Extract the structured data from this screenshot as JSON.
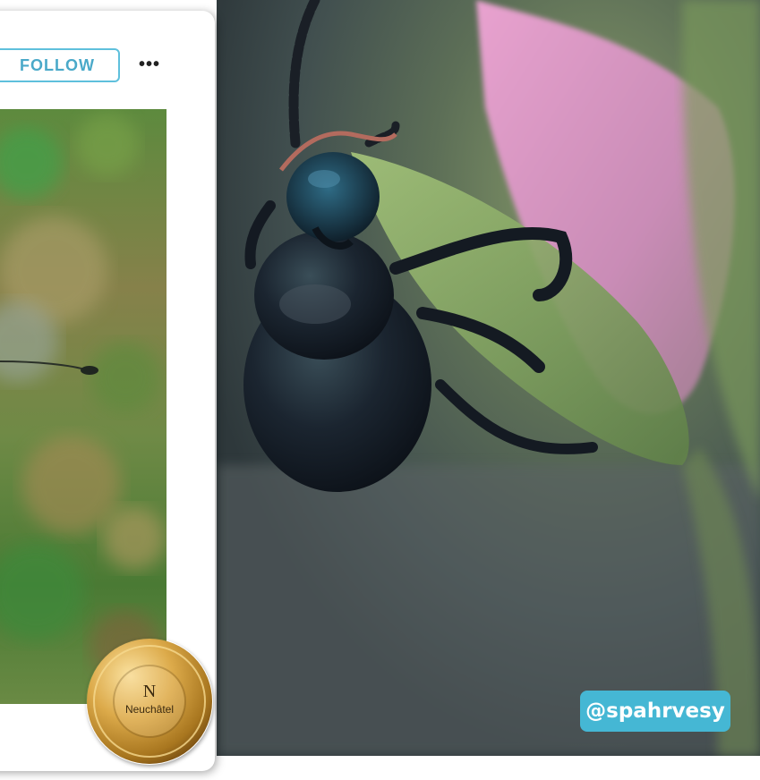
{
  "post": {
    "follow_label": "FOLLOW",
    "more_label": "•••"
  },
  "badge": {
    "logo_text": "Neuchâtel",
    "logo_mark": "N"
  },
  "handle": {
    "text": "@spahrvesy"
  },
  "colors": {
    "accent": "#45b7d4",
    "follow_border": "#5fc0dc",
    "badge_gold": "#d9a63c"
  },
  "icons": {
    "more": "more-dots-icon",
    "badge": "neuchatel-logo-icon"
  }
}
